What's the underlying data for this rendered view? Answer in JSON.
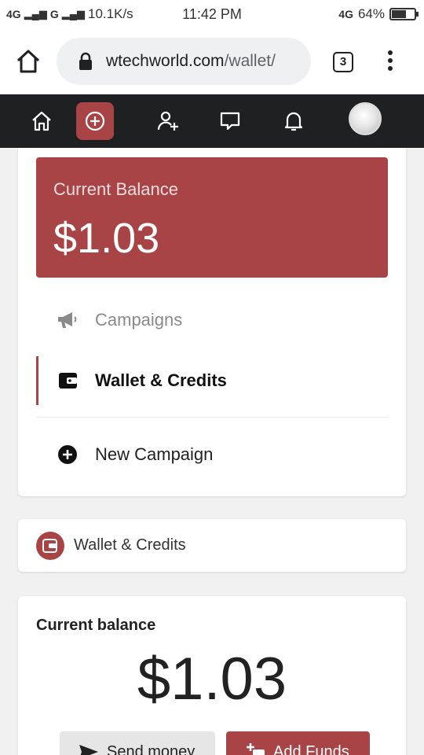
{
  "status_bar": {
    "network_left": "4G",
    "network_left2": "G",
    "speed": "10.1K/s",
    "time": "11:42 PM",
    "network_right": "4G",
    "battery": "64%",
    "battery_level": 0.64
  },
  "browser": {
    "url_main": "wtechworld.com",
    "url_path": "/wallet/",
    "tab_count": "3"
  },
  "app_nav": {
    "items": [
      {
        "name": "home",
        "icon": "home-icon"
      },
      {
        "name": "create",
        "icon": "plus-circle-icon",
        "active": true
      },
      {
        "name": "add-user",
        "icon": "user-plus-icon"
      },
      {
        "name": "messages",
        "icon": "message-icon"
      },
      {
        "name": "notifications",
        "icon": "bell-icon"
      }
    ]
  },
  "balance_card": {
    "label": "Current Balance",
    "amount": "$1.03"
  },
  "side_menu": {
    "campaigns": "Campaigns",
    "wallet": "Wallet & Credits",
    "new_campaign": "New Campaign"
  },
  "section_header": {
    "title": "Wallet & Credits"
  },
  "wallet_panel": {
    "heading": "Current balance",
    "amount": "$1.03",
    "send_label": "Send money",
    "add_label": "Add Funds"
  },
  "colors": {
    "accent": "#a94446",
    "nav_bg": "#1f2021"
  }
}
